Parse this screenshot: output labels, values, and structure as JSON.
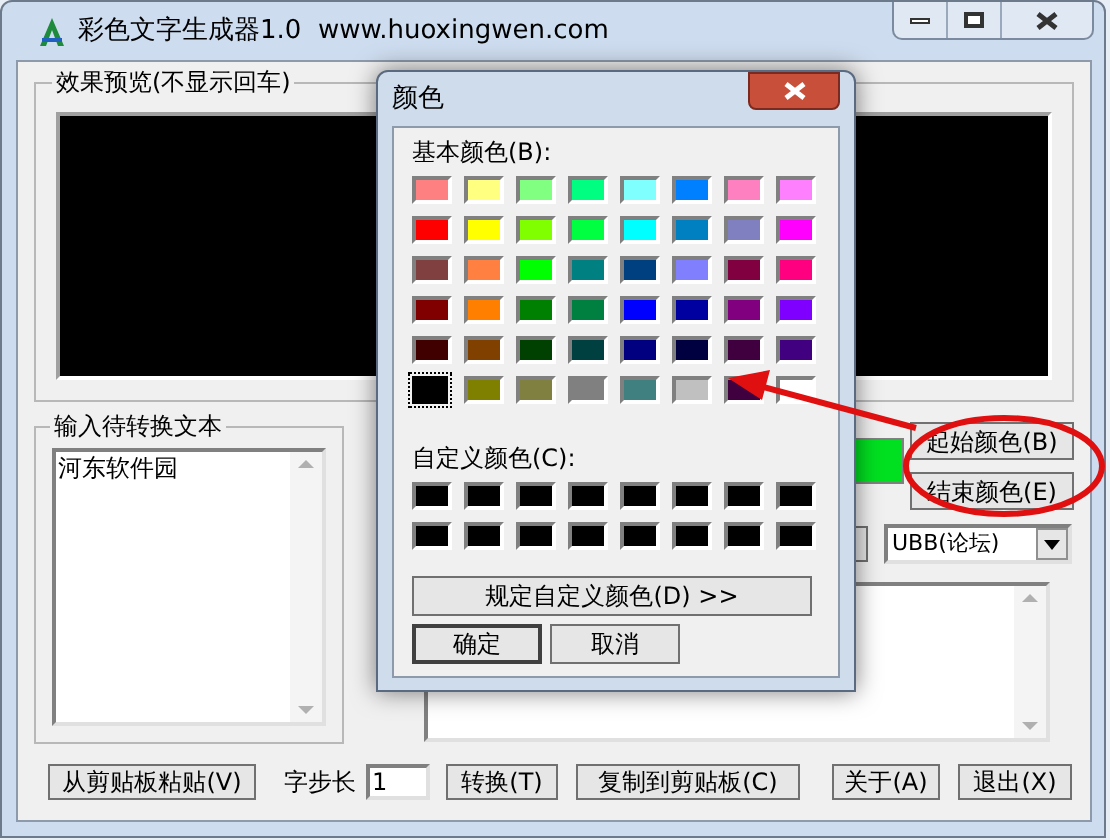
{
  "window": {
    "title": "彩色文字生成器1.0  www.huoxingwen.com"
  },
  "preview": {
    "title": "效果预览(不显示回车)"
  },
  "input": {
    "title": "输入待转换文本",
    "value": "河东软件园"
  },
  "color_sample": {
    "color": "#00e020"
  },
  "color_buttons": [
    "起始颜色(B)",
    "结束颜色(E)"
  ],
  "format_combo": {
    "value": "UBB(论坛)"
  },
  "bottom": {
    "paste_button": "从剪贴板粘贴(V)",
    "step_label": "字步长",
    "step_value": "1",
    "convert_button": "转换(T)",
    "copy_button": "复制到剪贴板(C)",
    "about_button": "关于(A)",
    "exit_button": "退出(X)"
  },
  "color_dialog": {
    "title": "颜色",
    "basic_label": "基本颜色(B):",
    "basic_colors": [
      {
        "color": "#ff8080",
        "selected": false
      },
      {
        "color": "#ffff80",
        "selected": false
      },
      {
        "color": "#80ff80",
        "selected": false
      },
      {
        "color": "#00ff80",
        "selected": false
      },
      {
        "color": "#80ffff",
        "selected": false
      },
      {
        "color": "#0080ff",
        "selected": false
      },
      {
        "color": "#ff80c0",
        "selected": false
      },
      {
        "color": "#ff80ff",
        "selected": false
      },
      {
        "color": "#ff0000",
        "selected": false
      },
      {
        "color": "#ffff00",
        "selected": false
      },
      {
        "color": "#80ff00",
        "selected": false
      },
      {
        "color": "#00ff40",
        "selected": false
      },
      {
        "color": "#00ffff",
        "selected": false
      },
      {
        "color": "#0080c0",
        "selected": false
      },
      {
        "color": "#8080c0",
        "selected": false
      },
      {
        "color": "#ff00ff",
        "selected": false
      },
      {
        "color": "#804040",
        "selected": false
      },
      {
        "color": "#ff8040",
        "selected": false
      },
      {
        "color": "#00ff00",
        "selected": false
      },
      {
        "color": "#008080",
        "selected": false
      },
      {
        "color": "#004080",
        "selected": false
      },
      {
        "color": "#8080ff",
        "selected": false
      },
      {
        "color": "#800040",
        "selected": false
      },
      {
        "color": "#ff0080",
        "selected": false
      },
      {
        "color": "#800000",
        "selected": false
      },
      {
        "color": "#ff8000",
        "selected": false
      },
      {
        "color": "#008000",
        "selected": false
      },
      {
        "color": "#008040",
        "selected": false
      },
      {
        "color": "#0000ff",
        "selected": false
      },
      {
        "color": "#0000a0",
        "selected": false
      },
      {
        "color": "#800080",
        "selected": false
      },
      {
        "color": "#8000ff",
        "selected": false
      },
      {
        "color": "#400000",
        "selected": false
      },
      {
        "color": "#804000",
        "selected": false
      },
      {
        "color": "#004000",
        "selected": false
      },
      {
        "color": "#004040",
        "selected": false
      },
      {
        "color": "#000080",
        "selected": false
      },
      {
        "color": "#000040",
        "selected": false
      },
      {
        "color": "#400040",
        "selected": false
      },
      {
        "color": "#400080",
        "selected": false
      },
      {
        "color": "#000000",
        "selected": true
      },
      {
        "color": "#808000",
        "selected": false
      },
      {
        "color": "#808040",
        "selected": false
      },
      {
        "color": "#808080",
        "selected": false
      },
      {
        "color": "#408080",
        "selected": false
      },
      {
        "color": "#c0c0c0",
        "selected": false
      },
      {
        "color": "#400040",
        "selected": false
      },
      {
        "color": "#ffffff",
        "selected": false
      }
    ],
    "custom_label": "自定义颜色(C):",
    "custom_colors": [
      {
        "color": "#000000"
      },
      {
        "color": "#000000"
      },
      {
        "color": "#000000"
      },
      {
        "color": "#000000"
      },
      {
        "color": "#000000"
      },
      {
        "color": "#000000"
      },
      {
        "color": "#000000"
      },
      {
        "color": "#000000"
      },
      {
        "color": "#000000"
      },
      {
        "color": "#000000"
      },
      {
        "color": "#000000"
      },
      {
        "color": "#000000"
      },
      {
        "color": "#000000"
      },
      {
        "color": "#000000"
      },
      {
        "color": "#000000"
      },
      {
        "color": "#000000"
      }
    ],
    "define_button": "规定自定义颜色(D) >>",
    "ok_button": "确定",
    "cancel_button": "取消"
  }
}
